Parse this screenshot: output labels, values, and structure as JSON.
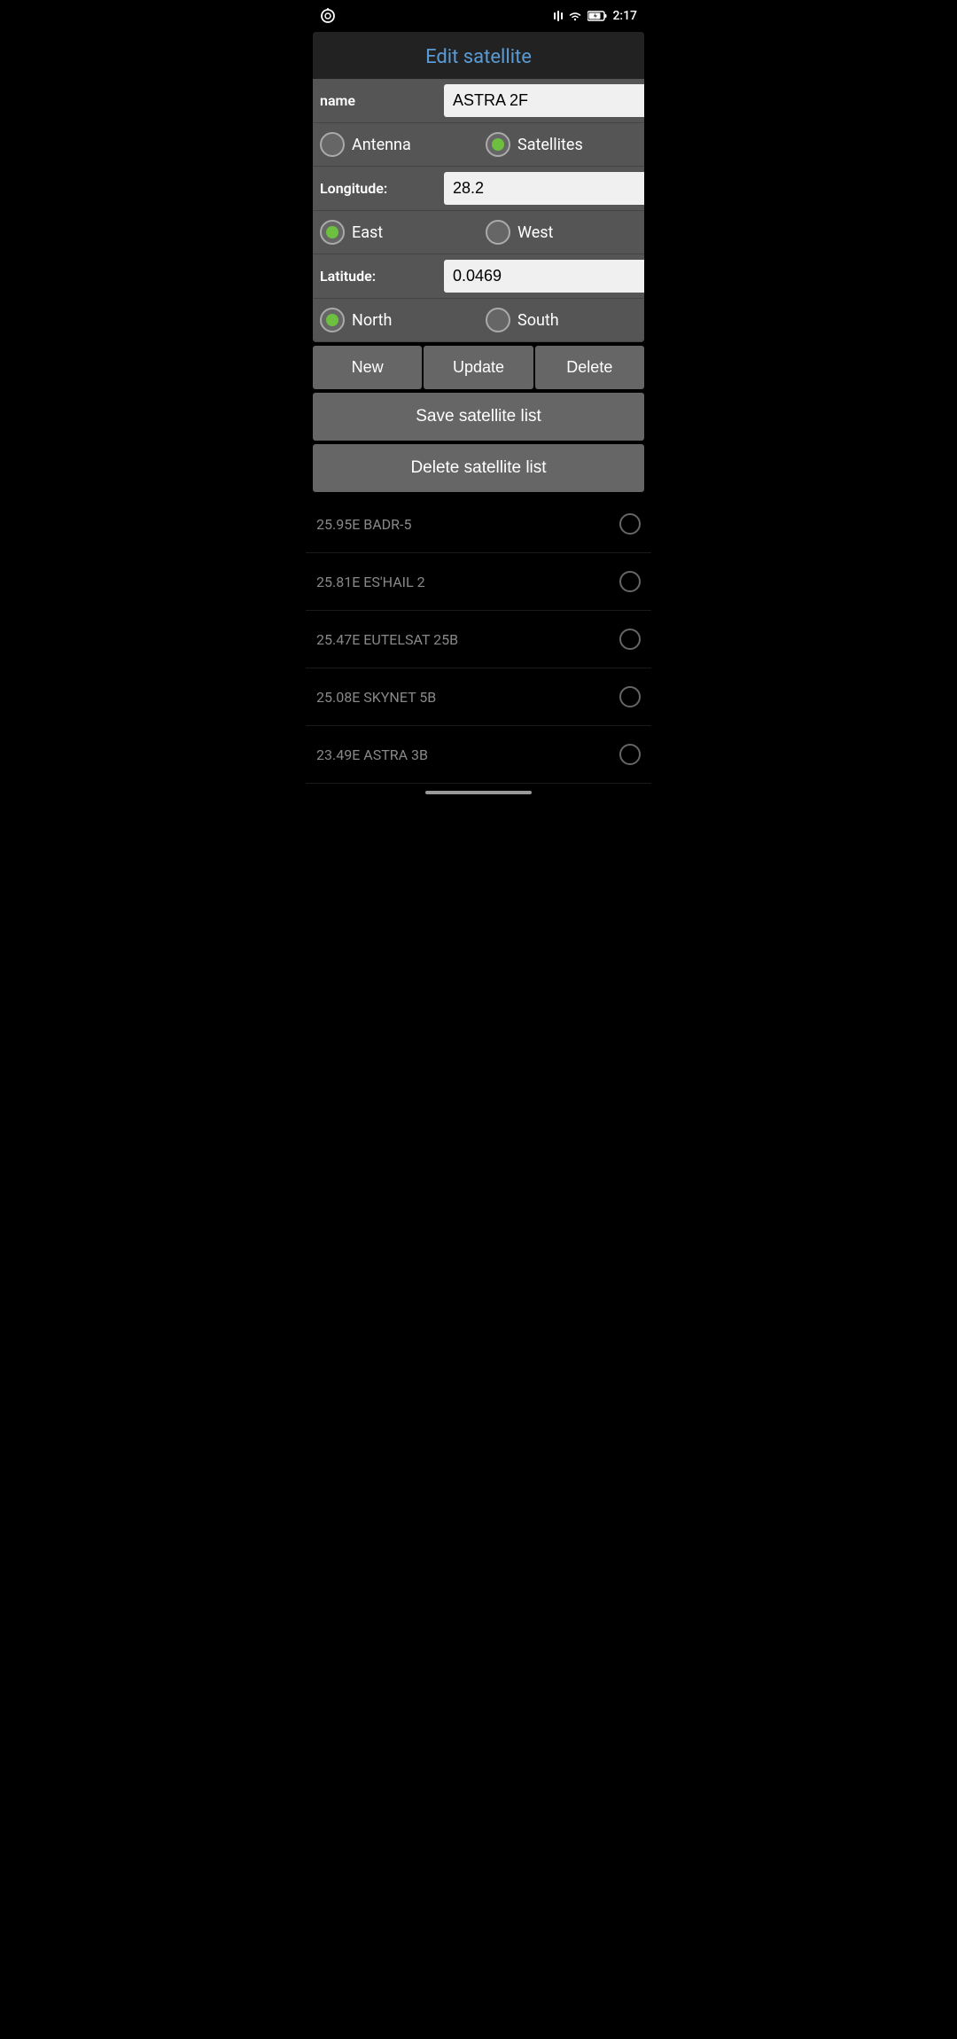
{
  "statusBar": {
    "time": "2:17"
  },
  "dialog": {
    "title": "Edit satellite",
    "nameLabel": "name",
    "nameValue": "ASTRA 2F",
    "antennaLabel": "Antenna",
    "satellitesLabel": "Satellites",
    "satellitesSelected": true,
    "antennaSelected": false,
    "longitudeLabel": "Longitude:",
    "longitudeValue": "28.2",
    "eastLabel": "East",
    "westLabel": "West",
    "eastSelected": true,
    "westSelected": false,
    "latitudeLabel": "Latitude:",
    "latitudeValue": "0.0469",
    "northLabel": "North",
    "southLabel": "South",
    "northSelected": true,
    "southSelected": false,
    "newButton": "New",
    "updateButton": "Update",
    "deleteButton": "Delete",
    "saveSatelliteList": "Save satellite list",
    "deleteSatelliteList": "Delete satellite list"
  },
  "satelliteList": [
    {
      "id": "badr5",
      "name": "25.95E BADR-5"
    },
    {
      "id": "eshail2",
      "name": "25.81E ES'HAIL 2"
    },
    {
      "id": "eutelsat25b",
      "name": "25.47E EUTELSAT 25B"
    },
    {
      "id": "skynet5b",
      "name": "25.08E SKYNET 5B"
    },
    {
      "id": "astra3b",
      "name": "23.49E ASTRA 3B"
    }
  ]
}
